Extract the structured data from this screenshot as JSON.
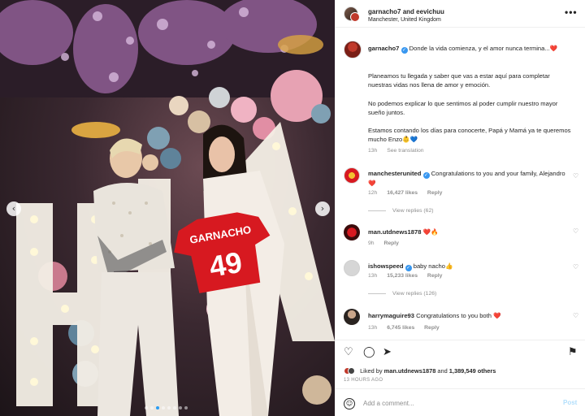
{
  "post": {
    "header": {
      "account_primary": "garnacho7",
      "joiner": "and",
      "account_secondary": "eevichuu",
      "location": "Manchester, United Kingdom",
      "more_icon": "more-horizontal-icon"
    },
    "photo": {
      "jersey_name": "GARNACHO",
      "jersey_number": "49",
      "carousel": {
        "total": 8,
        "active_index": 2
      },
      "prev_icon": "chevron-left-icon",
      "next_icon": "chevron-right-icon"
    },
    "caption": {
      "username": "garnacho7",
      "paragraphs": [
        "Donde la vida comienza, y el amor nunca termina...❤️",
        "Planeamos tu llegada y saber que vas a estar aquí para completar nuestras vidas nos llena de amor y emoción.",
        "No podemos explicar lo que sentimos al poder cumplir nuestro mayor sueño juntos.",
        "Estamos contando los días para conocerte, Papá y Mamá ya te queremos mucho Enzo👶💙"
      ],
      "time": "13h",
      "see_translation": "See translation"
    },
    "comments": [
      {
        "username": "manchesterunited",
        "verified": true,
        "text": "Congratulations to you and your family, Alejandro ❤️",
        "time": "12h",
        "likes": "16,427 likes",
        "reply": "Reply",
        "view_replies": "View replies (62)"
      },
      {
        "username": "man.utdnews1878",
        "verified": false,
        "text": "❤️🔥",
        "time": "9h",
        "likes": "",
        "reply": "Reply",
        "view_replies": ""
      },
      {
        "username": "ishowspeed",
        "verified": true,
        "text": "baby nacho👍",
        "time": "13h",
        "likes": "15,233 likes",
        "reply": "Reply",
        "view_replies": "View replies (126)"
      },
      {
        "username": "harrymaguire93",
        "verified": false,
        "text": "Congratulations to you both ❤️",
        "time": "13h",
        "likes": "6,745 likes",
        "reply": "Reply",
        "view_replies": ""
      }
    ],
    "actions": {
      "like_icon": "heart-icon",
      "comment_icon": "comment-icon",
      "share_icon": "send-icon",
      "save_icon": "bookmark-icon",
      "liked_by_prefix": "Liked by",
      "liked_by_user": "man.utdnews1878",
      "liked_by_and": "and",
      "liked_by_count": "1,389,549 others",
      "time_ago": "13 HOURS AGO"
    },
    "add_comment": {
      "placeholder": "Add a comment...",
      "post_label": "Post",
      "emoji_icon": "smiley-icon"
    }
  }
}
